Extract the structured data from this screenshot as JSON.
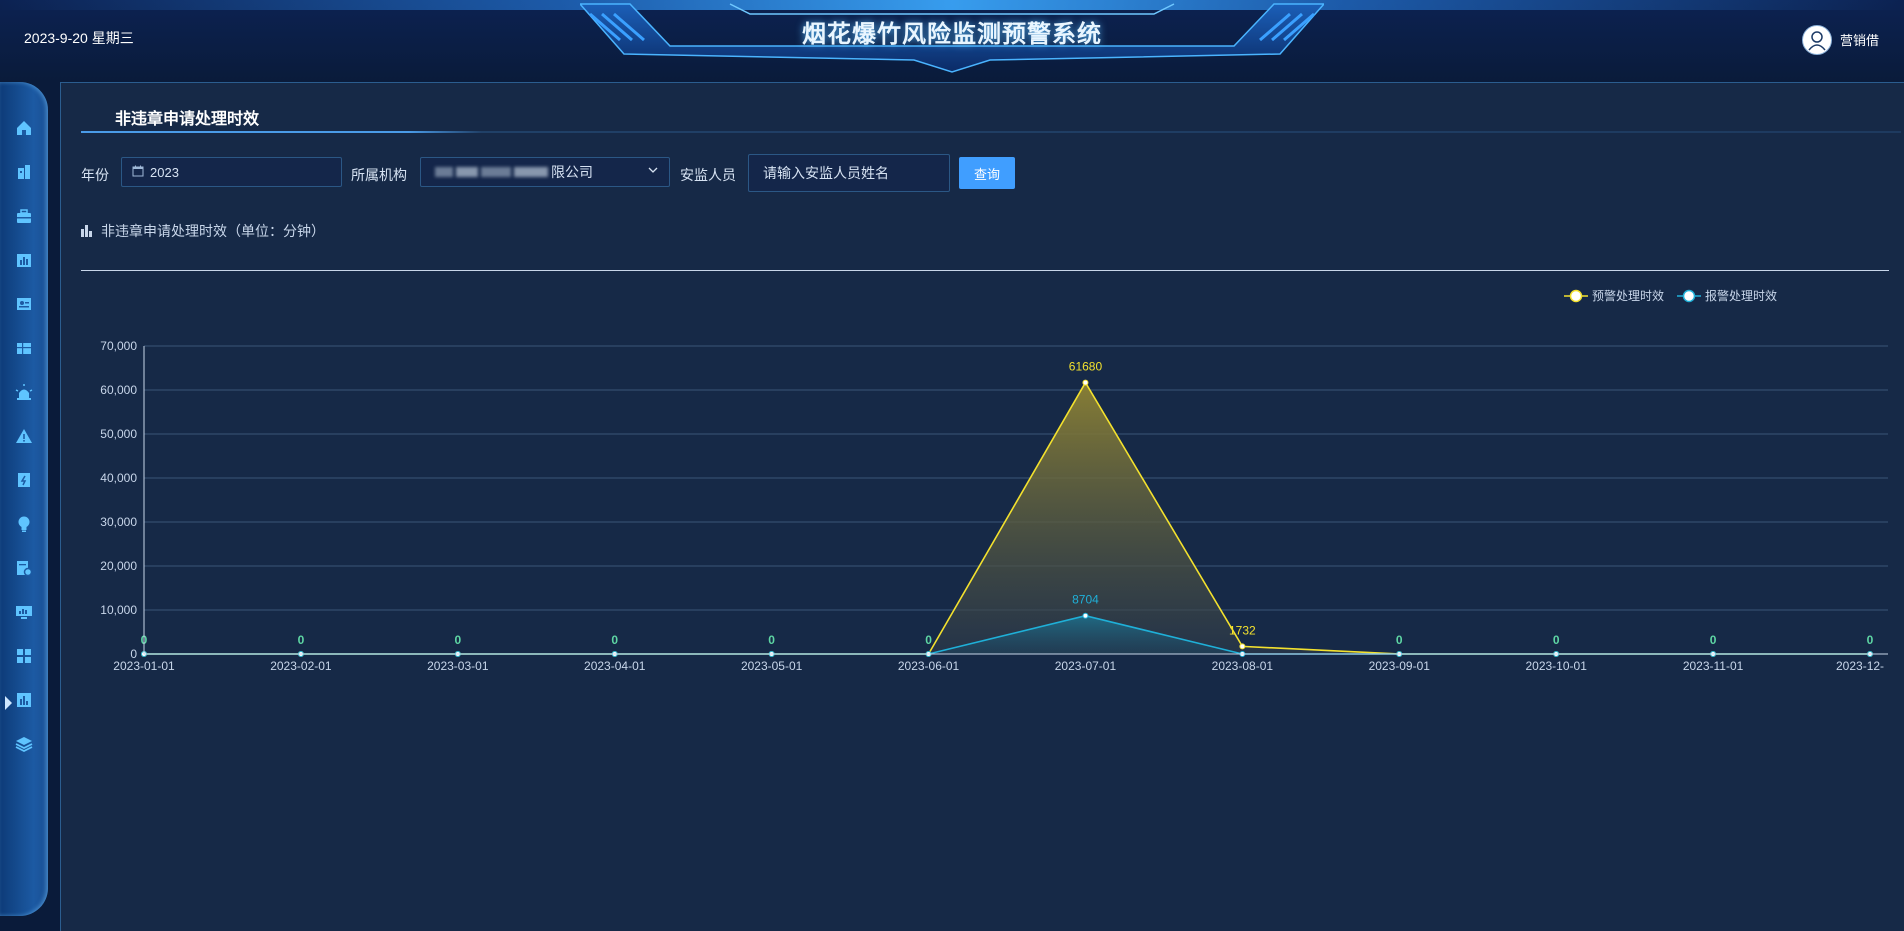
{
  "header": {
    "date": "2023-9-20 星期三",
    "system_title": "烟花爆竹风险监测预警系统",
    "username": "营销借"
  },
  "sidebar": {
    "items": [
      {
        "icon": "home-icon"
      },
      {
        "icon": "building-icon"
      },
      {
        "icon": "briefcase-icon"
      },
      {
        "icon": "bar-chart-icon"
      },
      {
        "icon": "id-card-icon"
      },
      {
        "icon": "table-icon"
      },
      {
        "icon": "alarm-light-icon"
      },
      {
        "icon": "warning-triangle-icon"
      },
      {
        "icon": "document-icon"
      },
      {
        "icon": "lightbulb-icon"
      },
      {
        "icon": "doc-settings-icon"
      },
      {
        "icon": "monitor-chart-icon",
        "active": true
      },
      {
        "icon": "grid-icon"
      },
      {
        "icon": "chart-box-icon"
      },
      {
        "icon": "layers-icon"
      }
    ]
  },
  "panel": {
    "title": "非违章申请处理时效"
  },
  "filters": {
    "year_label": "年份",
    "year_value": "2023",
    "org_label": "所属机构",
    "org_value_visible": "限公司",
    "inspector_label": "安监人员",
    "inspector_placeholder": "请输入安监人员姓名",
    "query_button": "查询"
  },
  "chart_section": {
    "heading": "非违章申请处理时效（单位：分钟）"
  },
  "chart_data": {
    "type": "line",
    "title": "",
    "x": [
      "2023-01-01",
      "2023-02-01",
      "2023-03-01",
      "2023-04-01",
      "2023-05-01",
      "2023-06-01",
      "2023-07-01",
      "2023-08-01",
      "2023-09-01",
      "2023-10-01",
      "2023-11-01",
      "2023-12-"
    ],
    "series": [
      {
        "name": "预警处理时效",
        "values": [
          0,
          0,
          0,
          0,
          0,
          0,
          61680,
          1732,
          0,
          0,
          0,
          0
        ],
        "color": "#f3e12e",
        "area": true
      },
      {
        "name": "报警处理时效",
        "values": [
          0,
          0,
          0,
          0,
          0,
          0,
          8704,
          0,
          0,
          0,
          0,
          0
        ],
        "color": "#1fb0d8",
        "area": true
      }
    ],
    "ylim": [
      0,
      70000
    ],
    "yticks": [
      "0",
      "10,000",
      "20,000",
      "30,000",
      "40,000",
      "50,000",
      "60,000",
      "70,000"
    ],
    "zero_label_color": "#5ed6a4",
    "grid": true,
    "legend": "top-right"
  },
  "colors": {
    "accent": "#409eff",
    "panel_bg": "#162947",
    "page_bg": "#0a1b3a"
  }
}
